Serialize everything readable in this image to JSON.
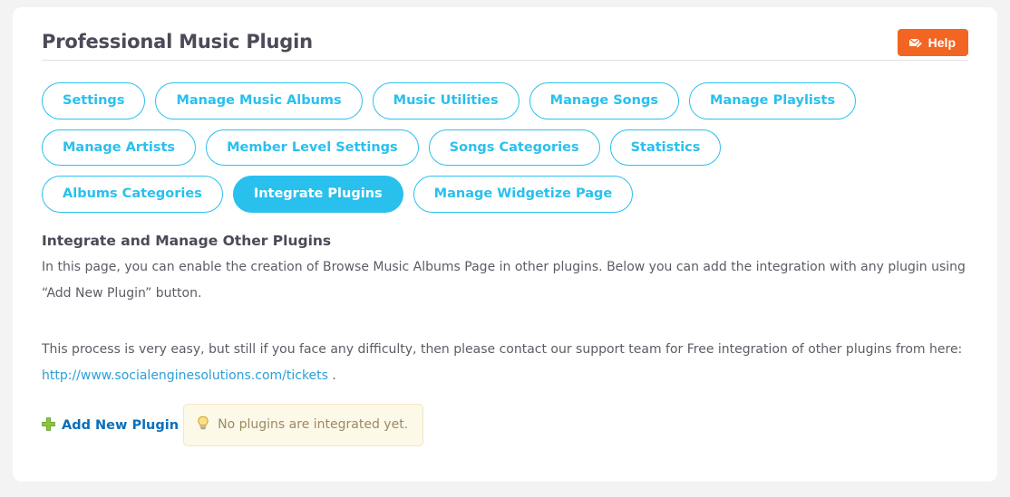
{
  "header": {
    "title": "Professional Music Plugin",
    "help_label": "Help",
    "help_icon": "envelope-icon",
    "help_color": "#f26522"
  },
  "tabs": {
    "accent_color": "#29c0ee",
    "items": [
      {
        "label": "Settings",
        "active": false
      },
      {
        "label": "Manage Music Albums",
        "active": false
      },
      {
        "label": "Music Utilities",
        "active": false
      },
      {
        "label": "Manage Songs",
        "active": false
      },
      {
        "label": "Manage Playlists",
        "active": false
      },
      {
        "label": "Manage Artists",
        "active": false
      },
      {
        "label": "Member Level Settings",
        "active": false
      },
      {
        "label": "Songs Categories",
        "active": false
      },
      {
        "label": "Statistics",
        "active": false
      },
      {
        "label": "Albums Categories",
        "active": false
      },
      {
        "label": "Integrate Plugins",
        "active": true
      },
      {
        "label": "Manage Widgetize Page",
        "active": false
      }
    ]
  },
  "main": {
    "section_title": "Integrate and Manage Other Plugins",
    "paragraph_1": "In this page, you can enable the creation of Browse Music Albums Page in other plugins. Below you can add the integration with any plugin using “Add New Plugin” button.",
    "paragraph_2_prefix": "This process is very easy, but still if you face any difficulty, then please contact our support team for Free integration of other plugins from here:",
    "support_link": "http://www.socialenginesolutions.com/tickets",
    "paragraph_2_suffix": ".",
    "add_plugin_label": "Add New Plugin",
    "add_plugin_icon": "plus-icon",
    "add_plugin_icon_color": "#8cc63f",
    "notice_text": "No plugins are integrated yet.",
    "notice_icon": "lightbulb-icon"
  }
}
